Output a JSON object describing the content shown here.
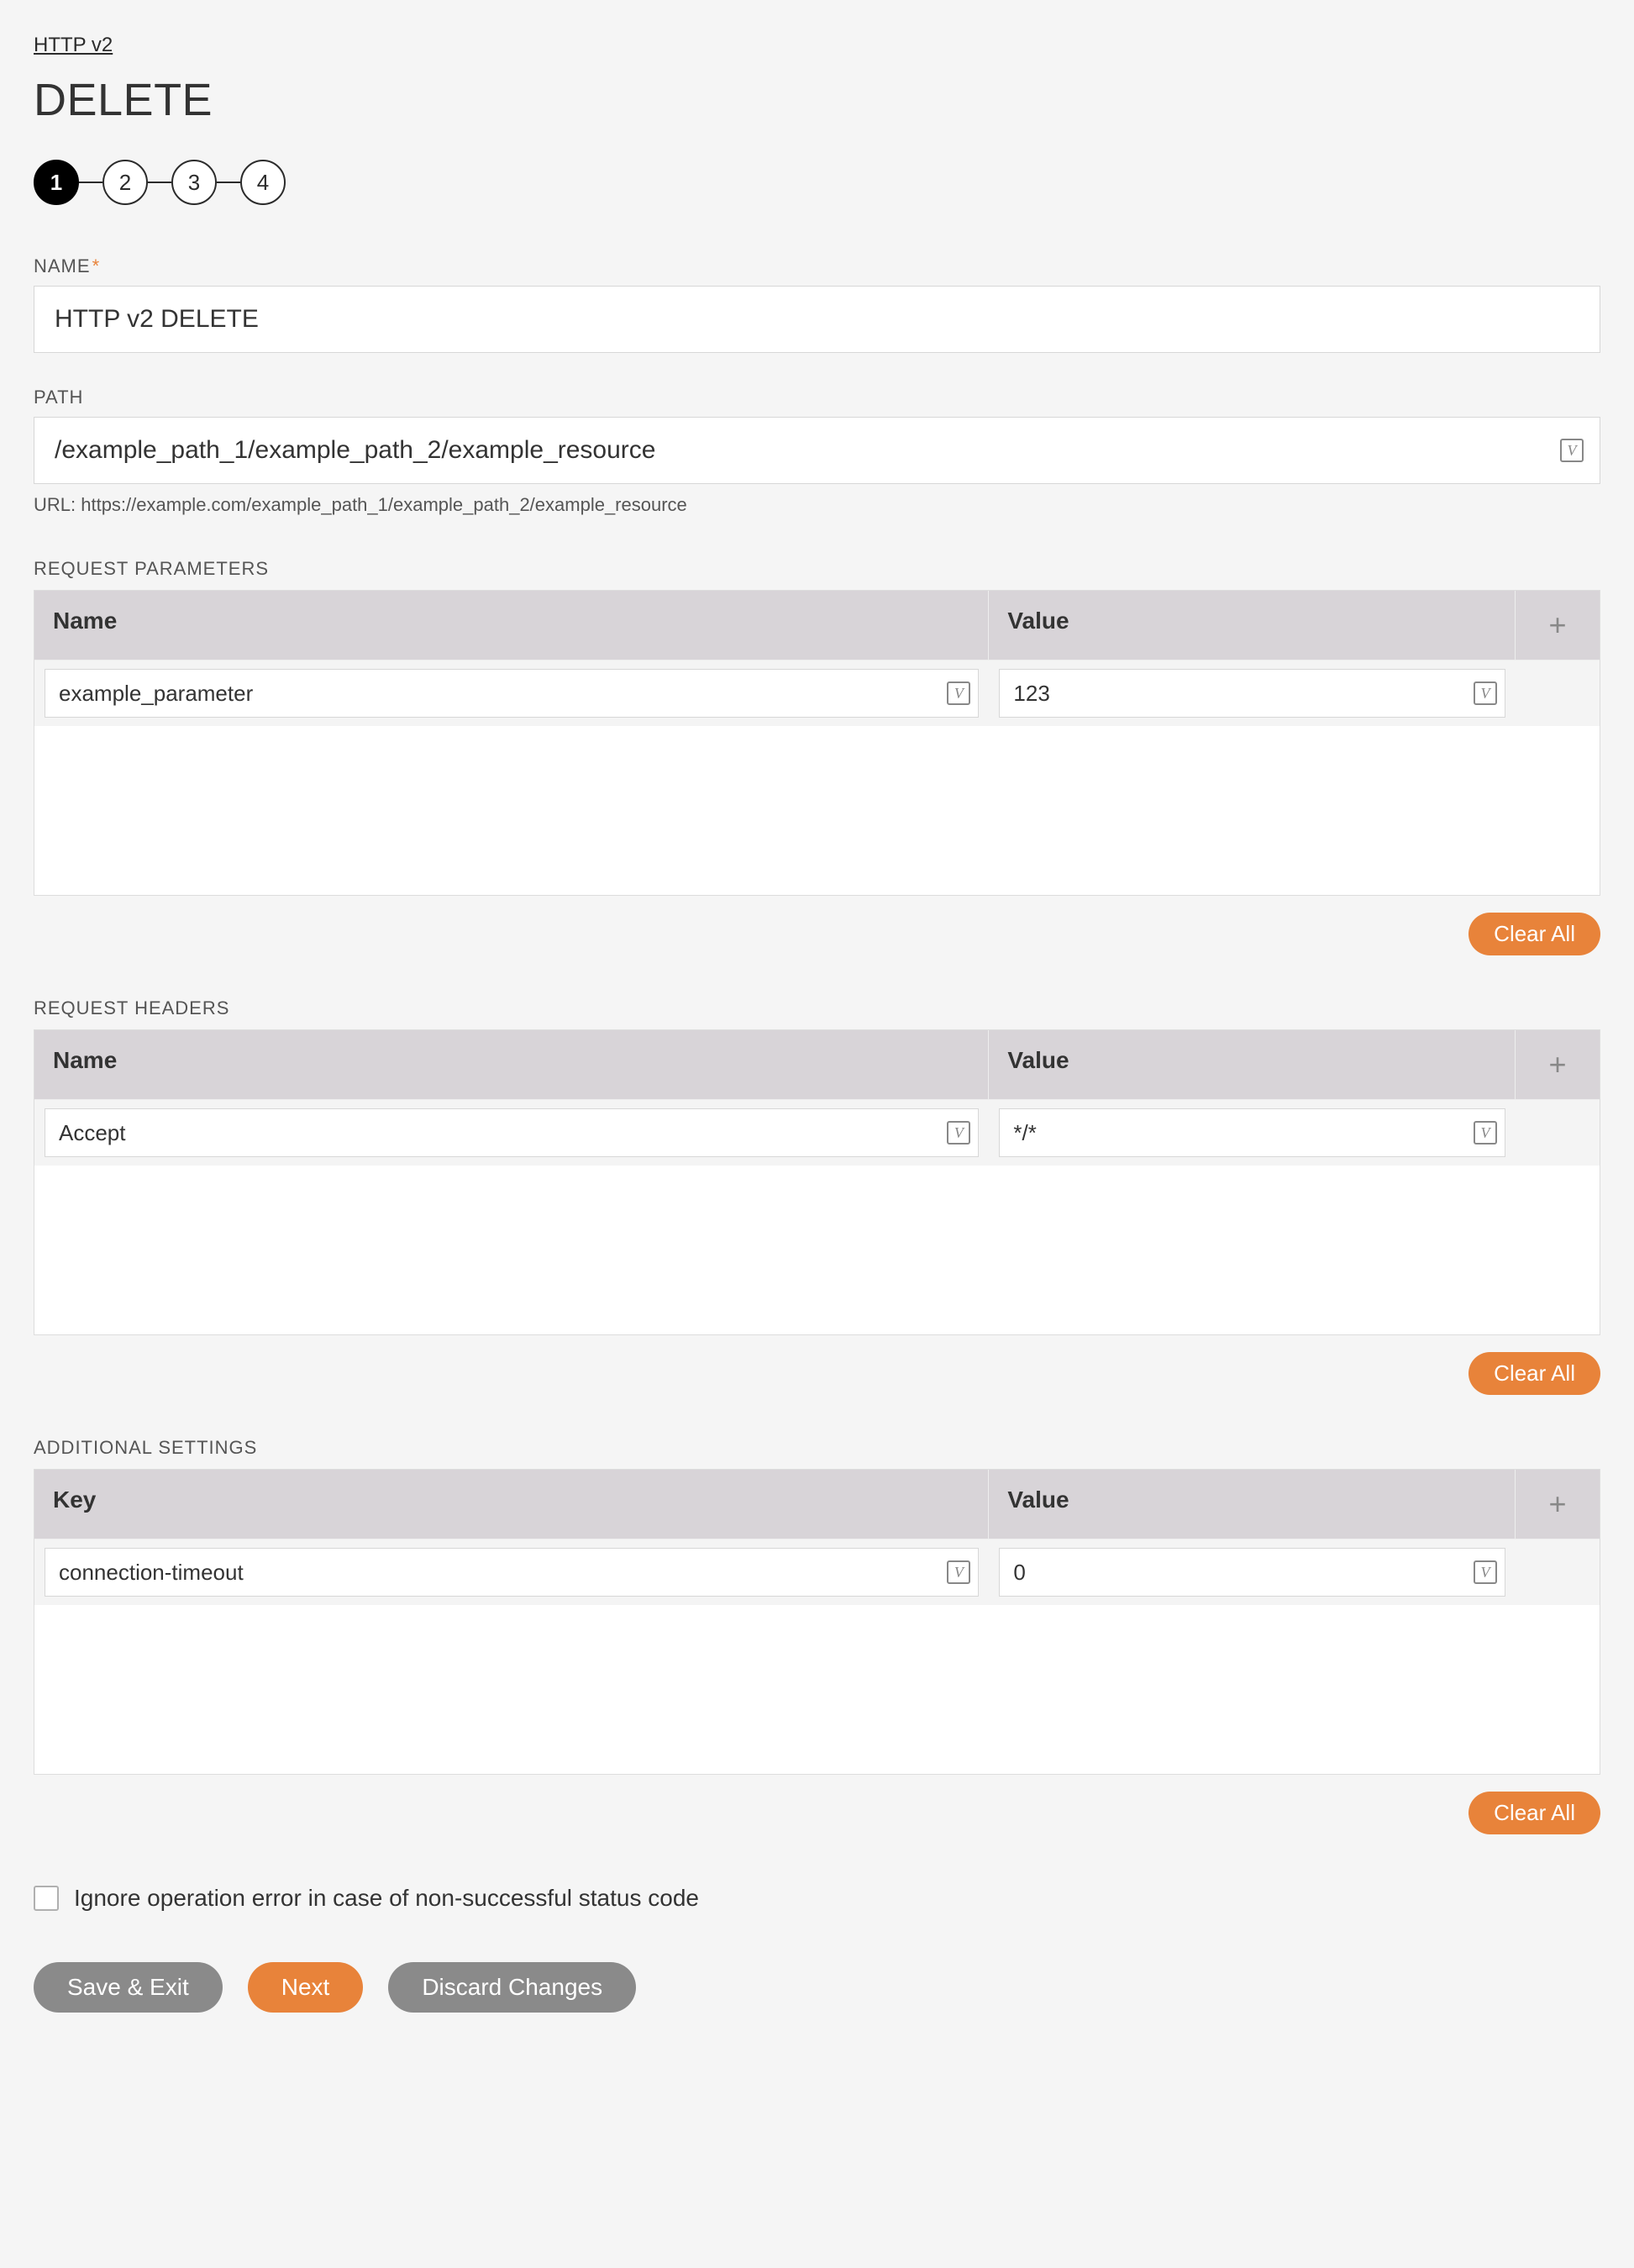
{
  "breadcrumb": {
    "label": "HTTP v2"
  },
  "title": "DELETE",
  "stepper": {
    "steps": [
      "1",
      "2",
      "3",
      "4"
    ],
    "active_index": 0
  },
  "fields": {
    "name": {
      "label": "NAME",
      "required": true,
      "value": "HTTP v2 DELETE"
    },
    "path": {
      "label": "PATH",
      "value": "/example_path_1/example_path_2/example_resource",
      "url_hint": "URL: https://example.com/example_path_1/example_path_2/example_resource"
    }
  },
  "request_parameters": {
    "label": "REQUEST PARAMETERS",
    "columns": {
      "name": "Name",
      "value": "Value"
    },
    "rows": [
      {
        "name": "example_parameter",
        "value": "123"
      }
    ],
    "clear_label": "Clear All"
  },
  "request_headers": {
    "label": "REQUEST HEADERS",
    "columns": {
      "name": "Name",
      "value": "Value"
    },
    "rows": [
      {
        "name": "Accept",
        "value": "*/*"
      }
    ],
    "clear_label": "Clear All"
  },
  "additional_settings": {
    "label": "ADDITIONAL SETTINGS",
    "columns": {
      "name": "Key",
      "value": "Value"
    },
    "rows": [
      {
        "name": "connection-timeout",
        "value": "0"
      }
    ],
    "clear_label": "Clear All"
  },
  "ignore_error": {
    "label": "Ignore operation error in case of non-successful status code",
    "checked": false
  },
  "footer": {
    "save_exit": "Save & Exit",
    "next": "Next",
    "discard": "Discard Changes"
  },
  "icons": {
    "variable_glyph": "V",
    "plus": "+"
  }
}
